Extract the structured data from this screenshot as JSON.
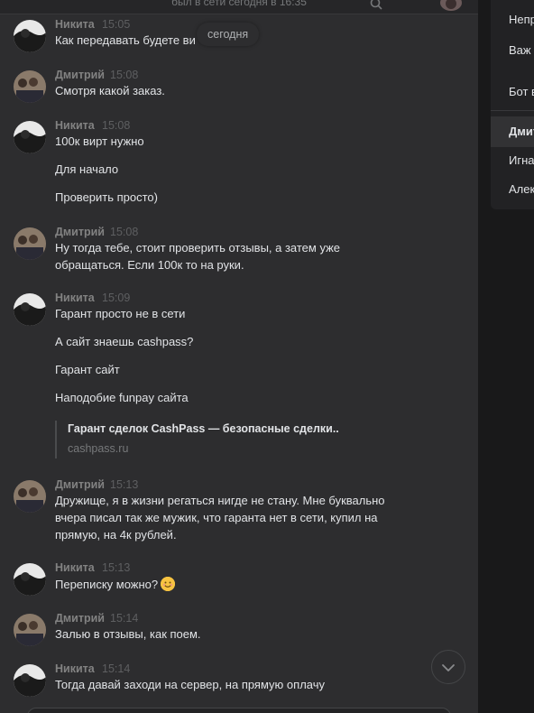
{
  "header": {
    "status": "был в сети сегодня в 16:35"
  },
  "date_separator": "сегодня",
  "messages": [
    {
      "author": "Никита",
      "time": "15:05",
      "lines": [
        "Как передавать будете ви"
      ]
    },
    {
      "author": "Дмитрий",
      "time": "15:08",
      "lines": [
        "Смотря какой заказ."
      ]
    },
    {
      "author": "Никита",
      "time": "15:08",
      "lines": [
        "100к вирт нужно",
        "Для начало",
        "Проверить просто)"
      ]
    },
    {
      "author": "Дмитрий",
      "time": "15:08",
      "lines": [
        "Ну тогда тебе, стоит проверить отзывы, а затем уже",
        "обращаться. Если 100к то на руки."
      ]
    },
    {
      "author": "Никита",
      "time": "15:09",
      "lines": [
        "Гарант просто не в сети",
        "А сайт знаешь cashpass?",
        "Гарант сайт",
        "Наподобие funpay сайта"
      ]
    },
    {
      "author": "Дмитрий",
      "time": "15:13",
      "lines": [
        "Дружище, я в жизни регаться нигде не стану. Мне буквально",
        "вчера писал так же мужик, что гаранта нет в сети, купил на",
        "прямую, на 4к рублей."
      ]
    },
    {
      "author": "Никита",
      "time": "15:13",
      "lines": [
        "Переписку можно?"
      ]
    },
    {
      "author": "Дмитрий",
      "time": "15:14",
      "lines": [
        "Залью в отзывы, как поем."
      ]
    },
    {
      "author": "Никита",
      "time": "15:14",
      "lines": [
        "Тогда давай заходи на сервер, на прямую оплачу"
      ]
    }
  ],
  "link_card": {
    "title": "Гарант сделок CashPass — безопасные сделки..",
    "domain": "cashpass.ru"
  },
  "emoji_icon": "smiling-face-emoji",
  "sidebar": {
    "items": [
      {
        "label": "Непр"
      },
      {
        "label": "Важ"
      },
      {
        "label": "Бот в"
      },
      {
        "label": "Дмит"
      },
      {
        "label": "Игна"
      },
      {
        "label": "Алек"
      }
    ]
  },
  "colors": {
    "background": "#19191a",
    "chat_background": "#2d2d2f",
    "sidebar_background": "#222224",
    "text": "#e1e3e6",
    "muted": "#828282"
  }
}
